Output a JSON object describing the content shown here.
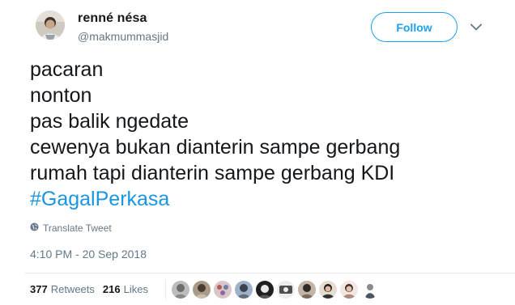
{
  "user": {
    "display_name": "renné nésa",
    "handle": "@makmummasjid",
    "avatar_icon": "user-avatar"
  },
  "follow_button": {
    "label": "Follow",
    "color": "#1da1f2"
  },
  "menu": {
    "icon": "chevron-down-icon"
  },
  "tweet": {
    "lines": [
      "pacaran",
      "nonton",
      "pas balik ngedate",
      "cewenya bukan dianterin sampe gerbang",
      "rumah tapi dianterin sampe gerbang KDI"
    ],
    "hashtag": "#GagalPerkasa",
    "hashtag_color": "#1b95e0"
  },
  "translate": {
    "label": "Translate Tweet",
    "icon": "globe-icon"
  },
  "timestamp": "4:10 PM - 20 Sep 2018",
  "stats": {
    "retweets_count": "377",
    "retweets_label": "Retweets",
    "likes_count": "216",
    "likes_label": "Likes"
  },
  "likers_count_shown": 10
}
